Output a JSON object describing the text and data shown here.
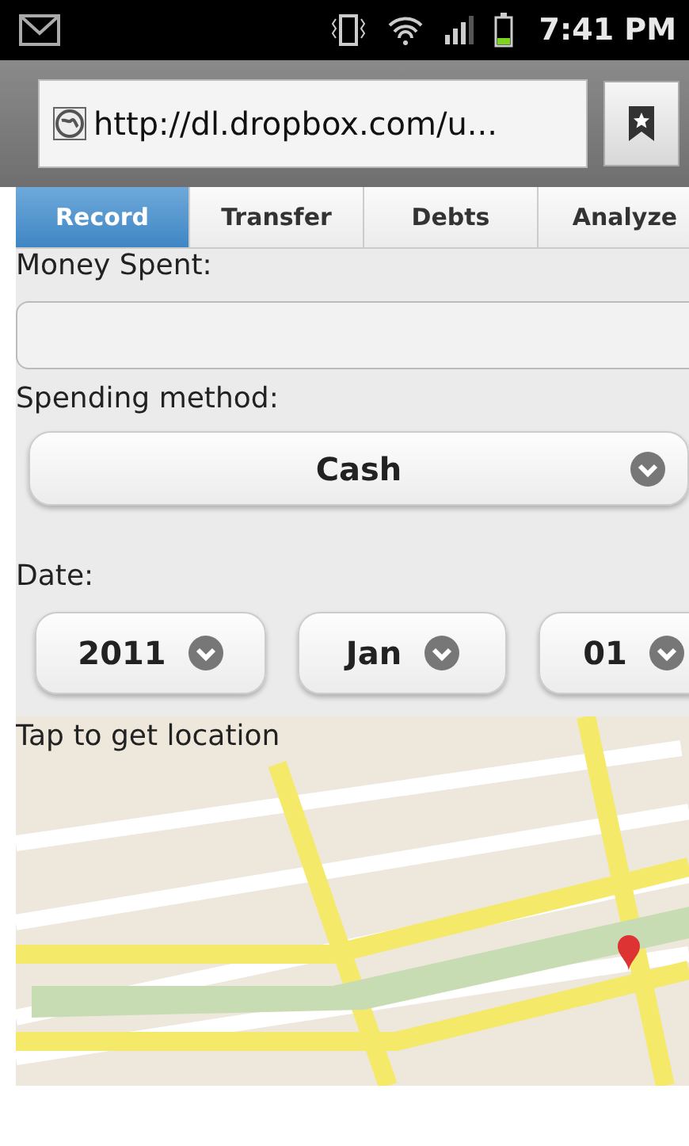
{
  "status_bar": {
    "time": "7:41 PM"
  },
  "browser": {
    "url": "http://dl.dropbox.com/u..."
  },
  "tabs": [
    {
      "label": "Record",
      "selected": true
    },
    {
      "label": "Transfer",
      "selected": false
    },
    {
      "label": "Debts",
      "selected": false
    },
    {
      "label": "Analyze",
      "selected": false
    }
  ],
  "form": {
    "money_label": "Money Spent:",
    "method_label": "Spending method:",
    "method_value": "Cash",
    "date_label": "Date:",
    "date_selects": [
      "2011",
      "Jan",
      "01"
    ]
  },
  "map": {
    "caption": "Tap to get location"
  }
}
